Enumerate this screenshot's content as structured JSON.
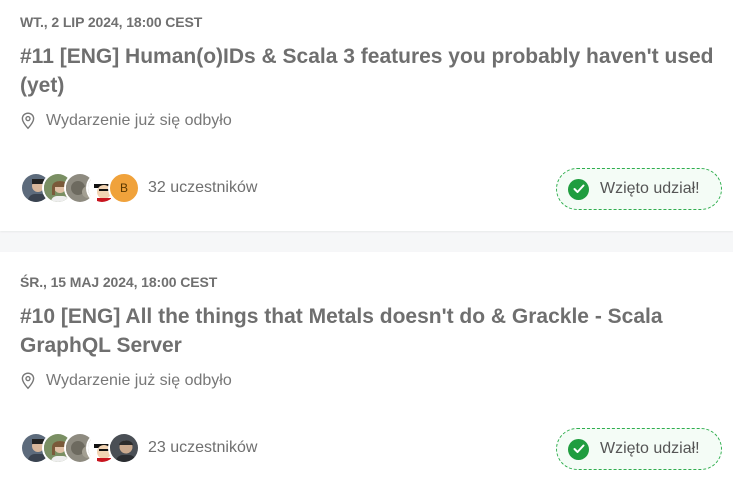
{
  "events": [
    {
      "date": "WT., 2 LIP 2024, 18:00 CEST",
      "title": "#11 [ENG] Human(o)IDs & Scala 3 features you probably haven't used (yet)",
      "location": "Wydarzenie już się odbyło",
      "attendees_count": "32 uczestników",
      "avatar_initial": "B",
      "status": "Wzięto udział!"
    },
    {
      "date": "ŚR., 15 MAJ 2024, 18:00 CEST",
      "title": "#10 [ENG] All the things that Metals doesn't do & Grackle - Scala GraphQL Server",
      "location": "Wydarzenie już się odbyło",
      "attendees_count": "23 uczestników",
      "status": "Wzięto udział!"
    }
  ],
  "colors": {
    "badge_border": "#2fae4e",
    "check": "#1f9d3f",
    "initial_avatar": "#f0a23b"
  }
}
